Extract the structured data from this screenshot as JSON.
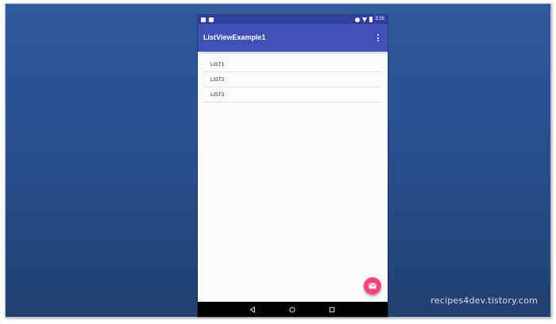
{
  "status_bar": {
    "time": "3:26",
    "icons": [
      "notification-icon",
      "sd-card-icon",
      "do-not-disturb-icon",
      "wifi-icon",
      "battery-icon"
    ]
  },
  "app_bar": {
    "title": "ListViewExample1",
    "menu_icon": "more-vertical-icon"
  },
  "list": {
    "items": [
      {
        "label": "LIST1"
      },
      {
        "label": "LIST2"
      },
      {
        "label": "LIST3"
      }
    ]
  },
  "fab": {
    "icon": "email-icon",
    "color": "#ff4081"
  },
  "nav_bar": {
    "buttons": [
      "back-icon",
      "home-icon",
      "recents-icon"
    ]
  },
  "watermark": "recipes4dev.tistory.com",
  "colors": {
    "primary": "#3f51b5",
    "primary_dark": "#303f9f",
    "accent": "#ff4081",
    "background": "#fafafa"
  }
}
